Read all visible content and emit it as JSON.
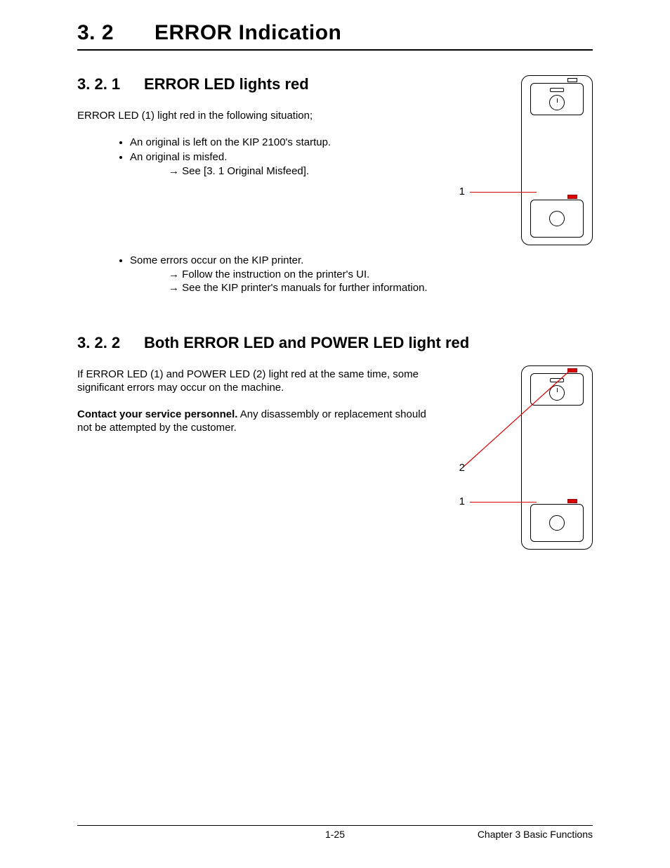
{
  "h1_num": "3. 2",
  "h1_txt": "ERROR Indication",
  "s1": {
    "num": "3. 2. 1",
    "title": "ERROR LED lights red",
    "intro": "ERROR LED (1) light red in the following situation;",
    "b1": "An original is left on the KIP 2100's startup.",
    "b2": "An original is misfed.",
    "b2s": "See [3. 1   Original Misfeed].",
    "b3": "Some errors occur on the KIP printer.",
    "b3s1": "Follow the instruction on the printer's UI.",
    "b3s2": "See the KIP printer's manuals for further information.",
    "lbl1": "1"
  },
  "s2": {
    "num": "3. 2. 2",
    "title": "Both ERROR LED and POWER LED light red",
    "p1": "If ERROR LED (1) and POWER LED (2) light red at the same time, some significant errors may occur on the machine.",
    "p2b": "Contact your service personnel.",
    "p2": " Any disassembly or replacement should not be attempted by the customer.",
    "lbl1": "1",
    "lbl2": "2"
  },
  "arrow": "→",
  "footer": {
    "page": "1-25",
    "chapter": "Chapter 3   Basic Functions"
  }
}
